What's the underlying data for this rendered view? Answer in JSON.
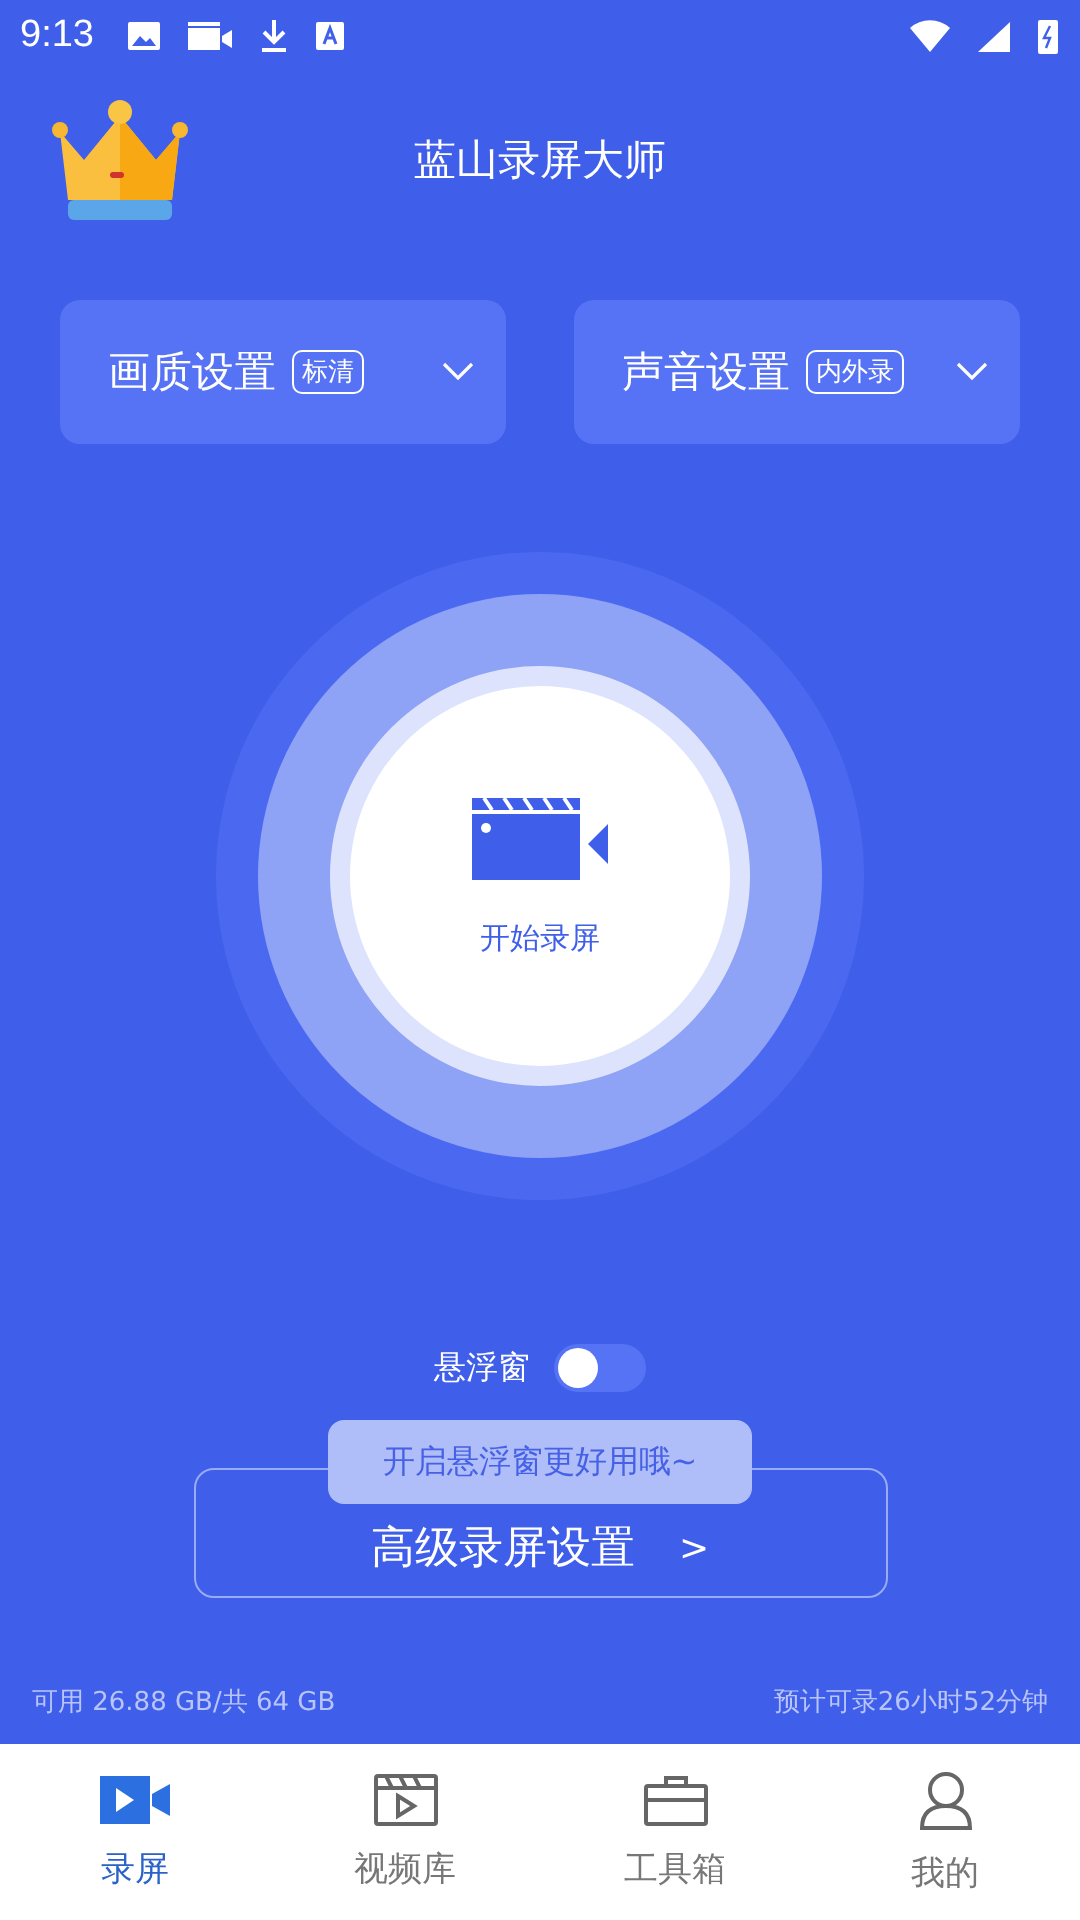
{
  "status_bar": {
    "time": "9:13"
  },
  "header": {
    "title": "蓝山录屏大师"
  },
  "selectors": [
    {
      "label": "画质设置",
      "badge": "标清"
    },
    {
      "label": "声音设置",
      "badge": "内外录"
    }
  ],
  "record_button": {
    "label": "开始录屏"
  },
  "floating_window": {
    "label": "悬浮窗",
    "on": false,
    "tooltip": "开启悬浮窗更好用哦~"
  },
  "advanced_button": {
    "label": "高级录屏设置",
    "arrow": ">"
  },
  "storage": {
    "available": "可用 26.88 GB/共 64 GB",
    "estimate": "预计可录26小时52分钟"
  },
  "nav": [
    {
      "label": "录屏",
      "kind": "record",
      "selected": true
    },
    {
      "label": "视频库",
      "kind": "library",
      "selected": false
    },
    {
      "label": "工具箱",
      "kind": "toolbox",
      "selected": false
    },
    {
      "label": "我的",
      "kind": "profile",
      "selected": false
    }
  ]
}
